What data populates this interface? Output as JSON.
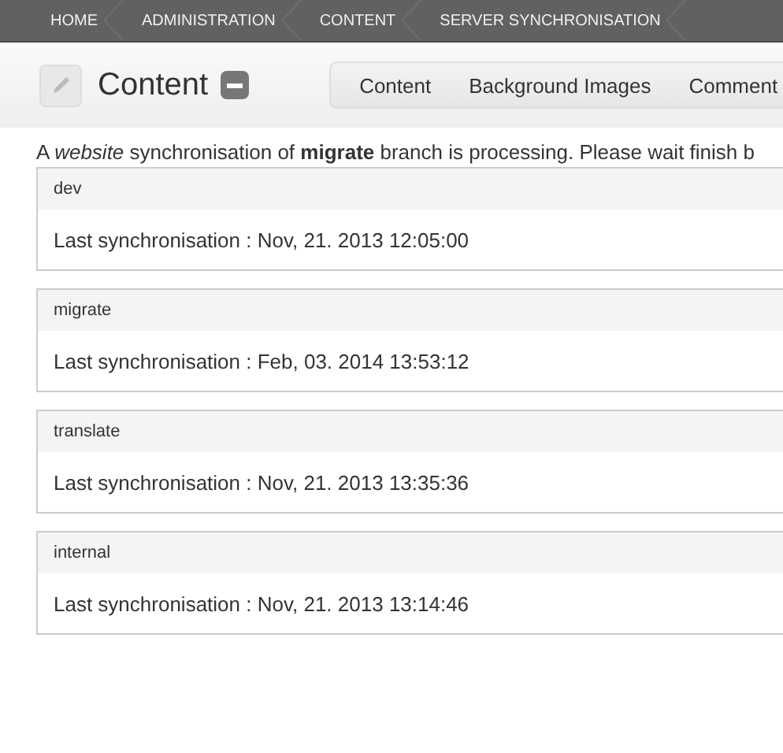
{
  "breadcrumb": [
    "HOME",
    "ADMINISTRATION",
    "CONTENT",
    "SERVER SYNCHRONISATION"
  ],
  "page": {
    "title": "Content"
  },
  "tabs": [
    "Content",
    "Background Images",
    "Comment"
  ],
  "message": "A *website* synchronisation of **migrate** branch is processing. Please wait finish b",
  "branches": [
    {
      "name": "dev",
      "last_sync": "Last synchronisation : Nov, 21. 2013 12:05:00"
    },
    {
      "name": "migrate",
      "last_sync": "Last synchronisation : Feb, 03. 2014 13:53:12"
    },
    {
      "name": "translate",
      "last_sync": "Last synchronisation : Nov, 21. 2013 13:35:36"
    },
    {
      "name": "internal",
      "last_sync": "Last synchronisation : Nov, 21. 2013 13:14:46"
    }
  ]
}
